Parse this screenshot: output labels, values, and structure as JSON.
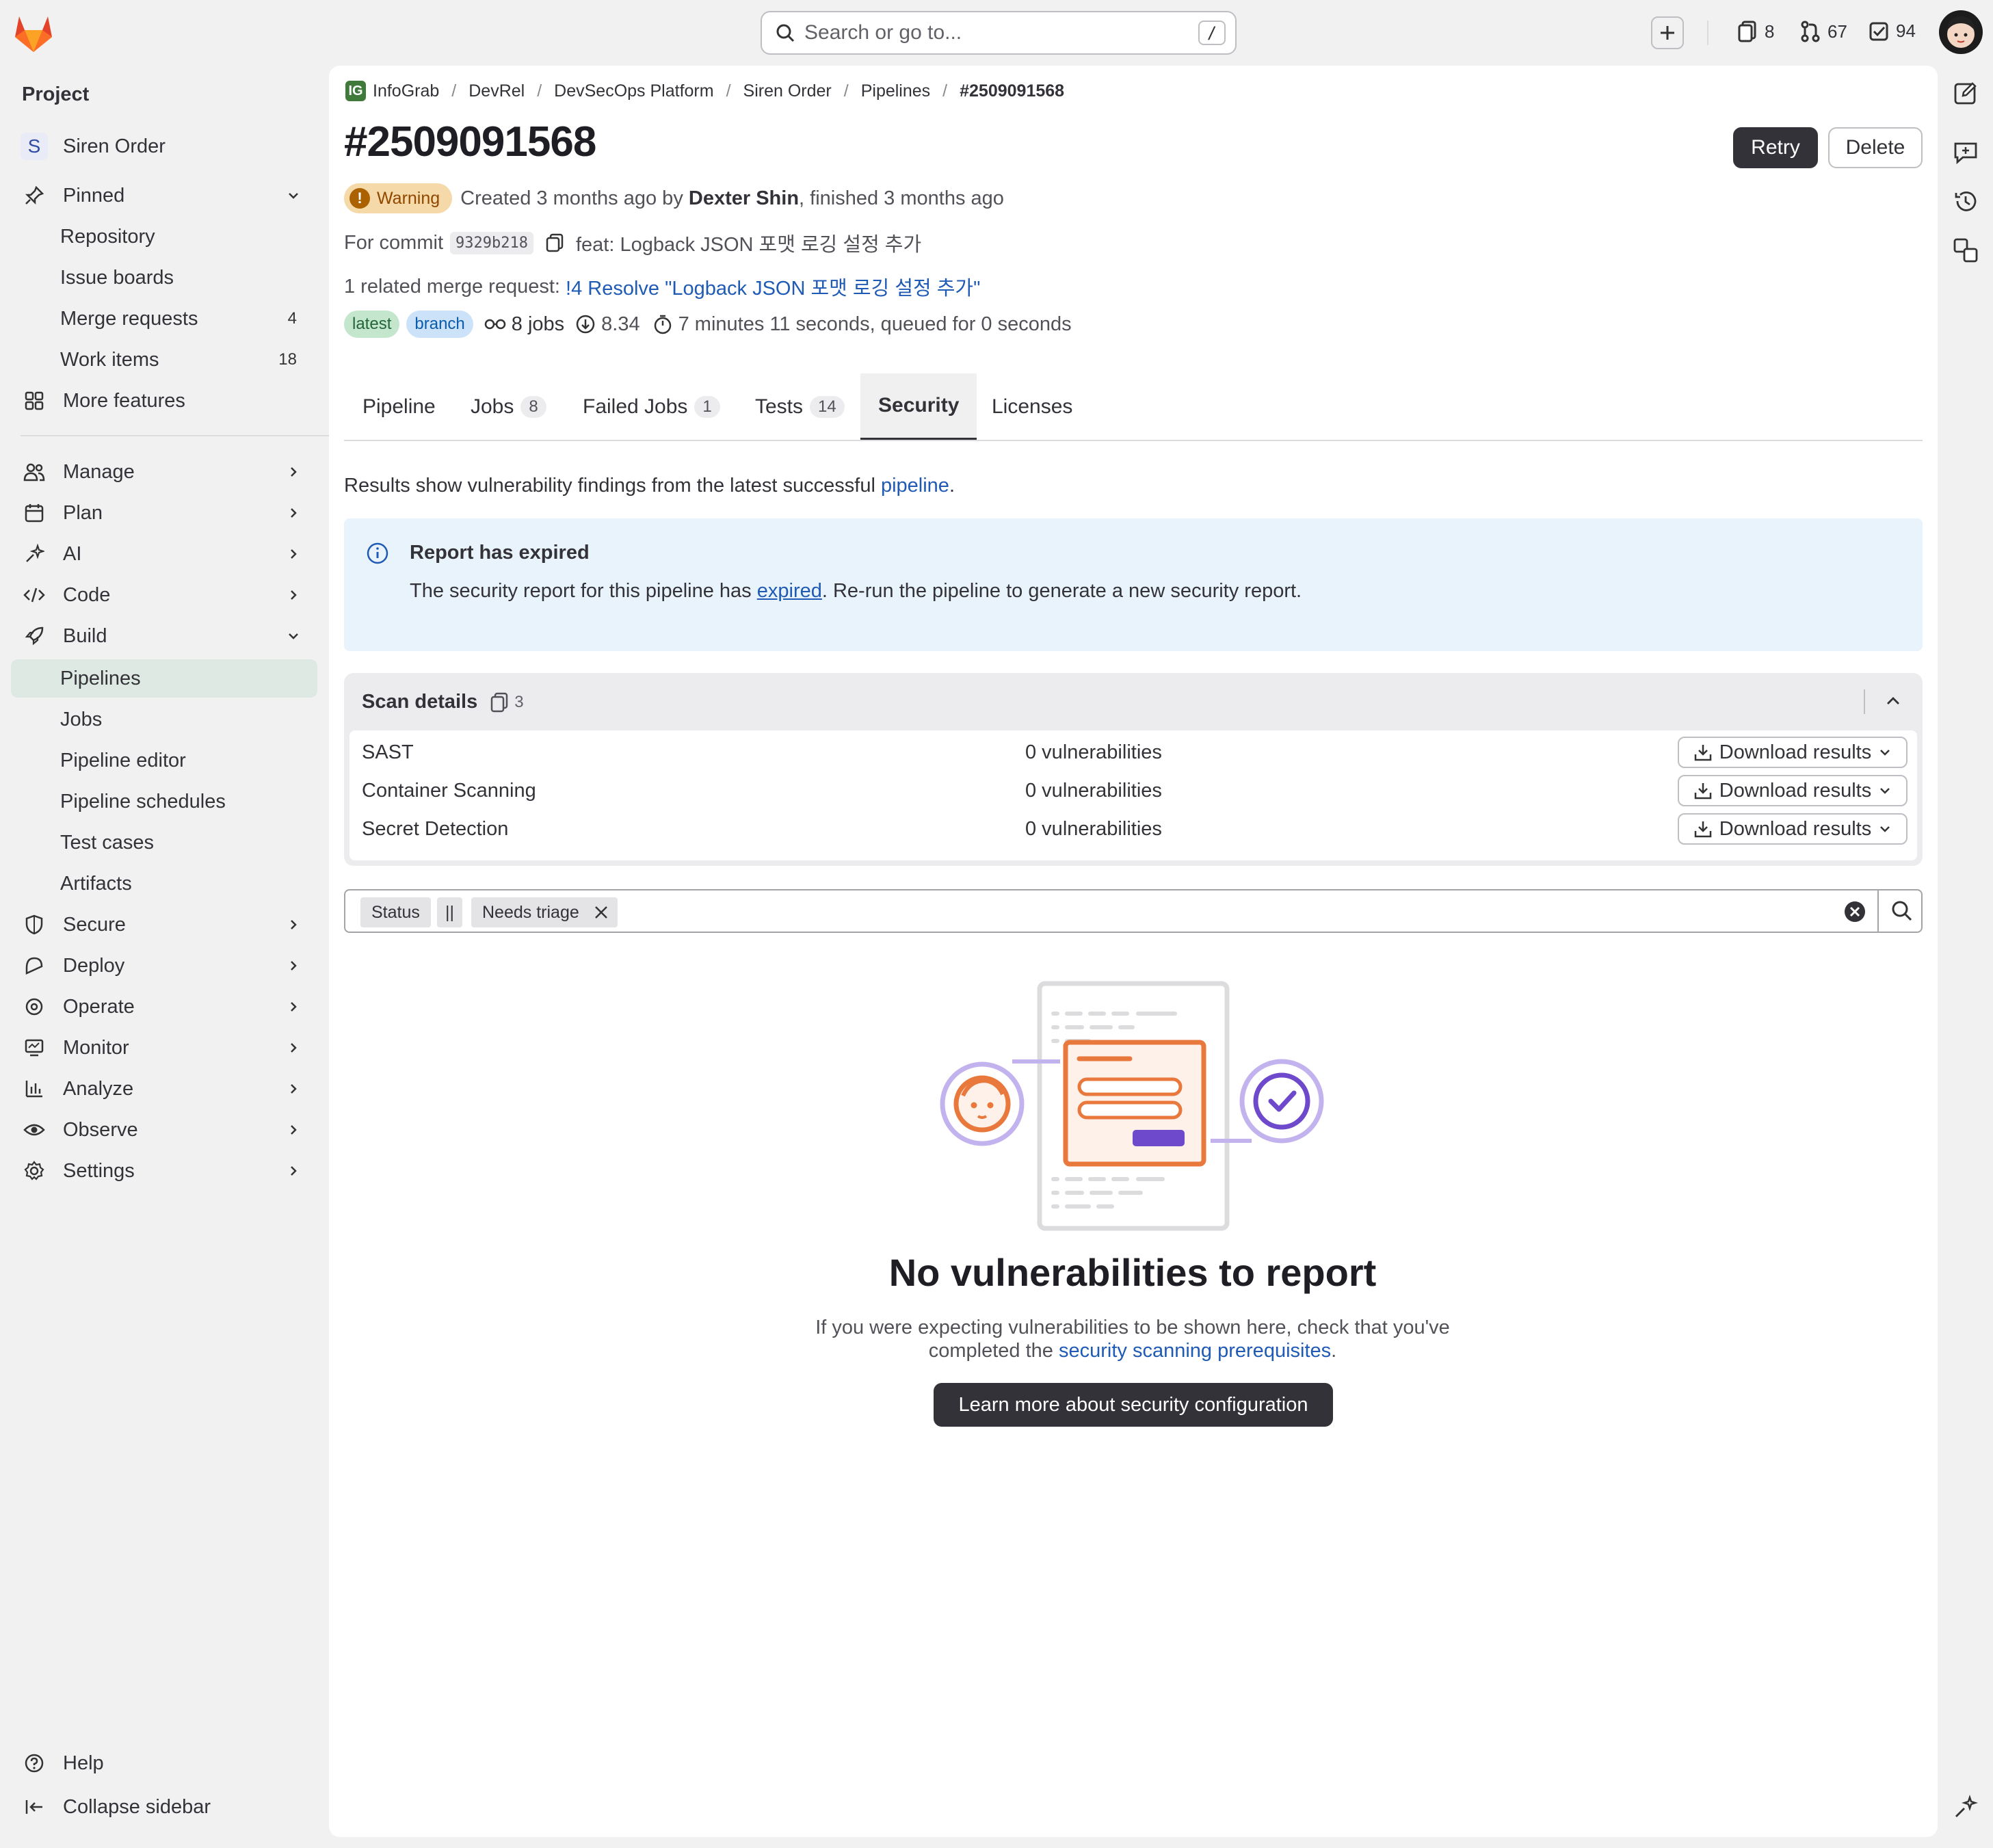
{
  "topbar": {
    "search_placeholder": "Search or go to...",
    "search_shortcut": "/",
    "issues_count": "8",
    "merge_requests_count": "67",
    "todos_count": "94"
  },
  "sidebar": {
    "section_title": "Project",
    "project_initial": "S",
    "project_name": "Siren Order",
    "pinned_label": "Pinned",
    "pinned_items": [
      {
        "label": "Repository",
        "count": ""
      },
      {
        "label": "Issue boards",
        "count": ""
      },
      {
        "label": "Merge requests",
        "count": "4"
      },
      {
        "label": "Work items",
        "count": "18"
      }
    ],
    "more_features": "More features",
    "groups": [
      "Manage",
      "Plan",
      "AI",
      "Code",
      "Build"
    ],
    "build_items": [
      "Pipelines",
      "Jobs",
      "Pipeline editor",
      "Pipeline schedules",
      "Test cases",
      "Artifacts"
    ],
    "groups_after": [
      "Secure",
      "Deploy",
      "Operate",
      "Monitor",
      "Analyze",
      "Observe",
      "Settings"
    ],
    "help": "Help",
    "collapse": "Collapse sidebar"
  },
  "breadcrumb": [
    "InfoGrab",
    "DevRel",
    "DevSecOps Platform",
    "Siren Order",
    "Pipelines",
    "#2509091568"
  ],
  "breadcrumb_badge": "IG",
  "pipeline": {
    "title": "#2509091568",
    "retry_label": "Retry",
    "delete_label": "Delete",
    "status": "Warning",
    "created_prefix": "Created 3 months ago by ",
    "author": "Dexter Shin",
    "finished": ", finished 3 months ago",
    "commit_prefix": "For commit",
    "commit_sha": "9329b218",
    "commit_message": "feat: Logback JSON 포맷 로깅 설정 추가",
    "mr_prefix": "1 related merge request: ",
    "mr_link": "!4 Resolve \"Logback JSON 포맷 로깅 설정 추가\"",
    "badge_latest": "latest",
    "badge_branch": "branch",
    "jobs": "8 jobs",
    "coverage": "8.34",
    "duration": "7 minutes 11 seconds, queued for 0 seconds"
  },
  "tabs": [
    {
      "label": "Pipeline",
      "count": ""
    },
    {
      "label": "Jobs",
      "count": "8"
    },
    {
      "label": "Failed Jobs",
      "count": "1"
    },
    {
      "label": "Tests",
      "count": "14"
    },
    {
      "label": "Security",
      "count": ""
    },
    {
      "label": "Licenses",
      "count": ""
    }
  ],
  "security": {
    "desc_prefix": "Results show vulnerability findings from the latest successful ",
    "desc_link": "pipeline",
    "desc_suffix": ".",
    "alert_title": "Report has expired",
    "alert_prefix": "The security report for this pipeline has ",
    "alert_link": "expired",
    "alert_suffix": ". Re-run the pipeline to generate a new security report.",
    "scan_title": "Scan details",
    "scan_count": "3",
    "scans": [
      {
        "name": "SAST",
        "result": "0 vulnerabilities",
        "action": "Download results"
      },
      {
        "name": "Container Scanning",
        "result": "0 vulnerabilities",
        "action": "Download results"
      },
      {
        "name": "Secret Detection",
        "result": "0 vulnerabilities",
        "action": "Download results"
      }
    ],
    "filter_token_key": "Status",
    "filter_token_op": "||",
    "filter_token_value": "Needs triage",
    "empty_title": "No vulnerabilities to report",
    "empty_desc_prefix": "If you were expecting vulnerabilities to be shown here, check that you've completed the ",
    "empty_desc_link": "security scanning prerequisites",
    "empty_desc_suffix": ".",
    "cta": "Learn more about security configuration"
  },
  "colors": {
    "accent": "#1f5bb5",
    "brand": "#e24329",
    "warning": "#ab6100",
    "illustration_orange": "#e9783d",
    "illustration_purple": "#6e49cb"
  }
}
